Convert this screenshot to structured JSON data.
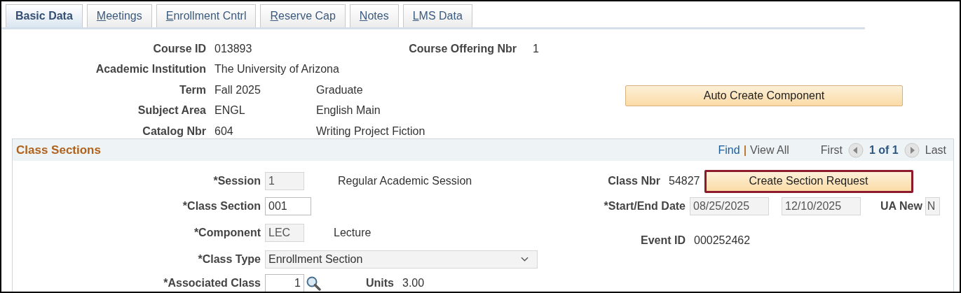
{
  "tabs": [
    {
      "label": "Basic Data",
      "selected": true,
      "access_key_underlined": false
    },
    {
      "label": "Meetings",
      "selected": false,
      "access_key_underlined": true
    },
    {
      "label": "Enrollment Cntrl",
      "selected": false,
      "access_key_underlined": true
    },
    {
      "label": "Reserve Cap",
      "selected": false,
      "access_key_underlined": true
    },
    {
      "label": "Notes",
      "selected": false,
      "access_key_underlined": true
    },
    {
      "label": "LMS Data",
      "selected": false,
      "access_key_underlined": true
    }
  ],
  "course": {
    "rows": [
      {
        "label": "Course ID",
        "value": "013893"
      },
      {
        "label": "Academic Institution",
        "value": "The University of Arizona"
      },
      {
        "label": "Term",
        "value": "Fall 2025",
        "detail": "Graduate"
      },
      {
        "label": "Subject Area",
        "value": "ENGL",
        "detail": "English Main"
      },
      {
        "label": "Catalog Nbr",
        "value": "604",
        "detail": "Writing Project Fiction"
      }
    ],
    "offering": {
      "label": "Course Offering Nbr",
      "value": "1"
    },
    "auto_create_button": "Auto Create Component"
  },
  "class_sections": {
    "title": "Class Sections",
    "nav": {
      "find": "Find",
      "separator": "|",
      "view_all": "View All",
      "first": "First",
      "position": "1 of 1",
      "last": "Last"
    },
    "fields": [
      {
        "kind": "readonly",
        "label": "*Session",
        "value": "1",
        "description": "Regular Academic Session"
      },
      {
        "kind": "input",
        "label": "*Class Section",
        "value": "001"
      },
      {
        "kind": "readonly",
        "label": "*Component",
        "value": "LEC",
        "description": "Lecture"
      },
      {
        "kind": "select",
        "label": "*Class Type",
        "value": "Enrollment Section"
      },
      {
        "kind": "lookup",
        "label": "*Associated Class",
        "value": "1",
        "extra_label": "Units",
        "extra_value": "3.00"
      }
    ],
    "class_nbr": {
      "label": "Class Nbr",
      "value": "54827"
    },
    "create_section_request": {
      "label": "Create Section Request",
      "highlighted": true
    },
    "start_end_date": {
      "label": "*Start/End Date",
      "start": "08/25/2025",
      "end": "12/10/2025"
    },
    "ua_new": {
      "label": "UA New",
      "value": "N"
    },
    "event_id": {
      "label": "Event ID",
      "value": "000252462"
    }
  }
}
